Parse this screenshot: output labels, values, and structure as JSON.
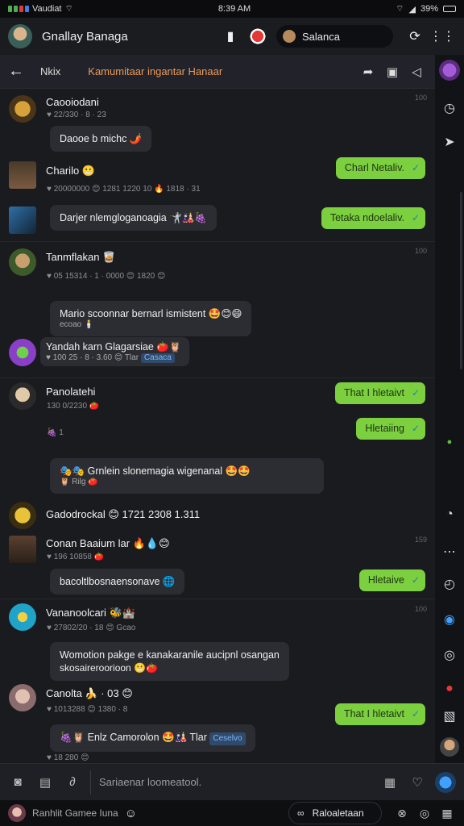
{
  "status": {
    "carrier": "Vaudiat",
    "time": "8:39 AM",
    "battery": "39%"
  },
  "header": {
    "title": "Gnallay Banaga",
    "search_label": "Salanca"
  },
  "subheader": {
    "tag": "Nkix",
    "breadcrumb": "Kamumitaar ingantar Hanaar"
  },
  "messages": [
    {
      "name": "Caooiodani",
      "meta": "♥ 22/330 · 8 · 23",
      "text": "Daooe b michc 🌶️",
      "time": "100"
    },
    {
      "name": "Charilo 😬",
      "meta": "♥ 20000000 😊 1281 1220 10 🔥 1818 · 31",
      "text": "Darjer nlemgloganoagia 🤺🎎🍇",
      "time": ""
    },
    {
      "name": "Tanmflakan 🥃",
      "meta": "♥ 05 15314 · 1 · 0000 😊 1820 😊",
      "text": "Mario scoonnar bernarl ismistent 🤩😊😄",
      "sub": "ecoao 🕯️",
      "time": "100"
    },
    {
      "name": "Yandah karn Glagarsiae 🍅🦉",
      "meta": "♥ 100 25 · 8 · 3.60 😊 Tlar",
      "badge": "Casaca",
      "time": ""
    },
    {
      "name": "Panolatehi",
      "meta": "130 0/2230 🍅",
      "time": ""
    },
    {
      "name": "",
      "meta": "🍇 1",
      "text": "🎭🎭 Grnlein slonemagia wigenanal 🤩🤩",
      "sub": "🦉 Rilg 🍅",
      "time": ""
    },
    {
      "name": "Gadodrockal 😊 1721 2308 1.311",
      "meta": "",
      "time": ""
    },
    {
      "name": "Conan Baaium lar 🔥💧😊",
      "meta": "♥ 196 10858 🍅",
      "text": "bacoltlbosnaensonave 🌐",
      "time": "159"
    },
    {
      "name": "Vananoolcari 🐝🏰",
      "meta": "♥ 27802/20 · 18 😊 Gcao",
      "text": "Womotion pakge e kanakaranile aucipnl osangan",
      "sub": "skosaireroorioon 😬🍅",
      "time": "100"
    },
    {
      "name": "Canolta 🍌 · 03 😊",
      "meta": "♥ 1013288 😊 1380 · 8",
      "text": "🍇🦉 Enlz Camorolon 🤩🎎 Tlar",
      "badge": "Ceselvo",
      "time": ""
    },
    {
      "name": "",
      "meta": "♥ 18 280 😊",
      "time": ""
    }
  ],
  "outgoing": [
    {
      "text": "Charl Netaliv."
    },
    {
      "text": "Tetaka ndoelaliv."
    },
    {
      "text": "That I hletaivt"
    },
    {
      "text": "Hletaiing"
    },
    {
      "text": "Hletaive"
    },
    {
      "text": "That I hletaivt"
    }
  ],
  "composer": {
    "placeholder": "Sariaenar loomeatool."
  },
  "footer": {
    "user": "Ranhlit Gamee Iuna",
    "pill_label": "Raloaletaan"
  }
}
